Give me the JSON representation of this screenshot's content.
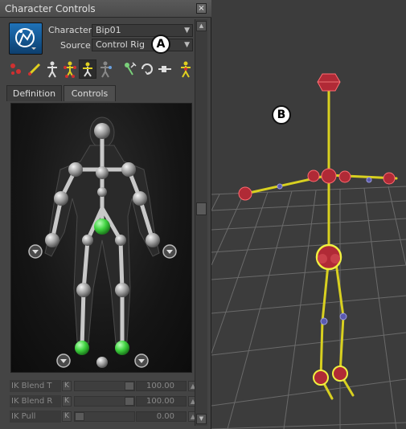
{
  "window": {
    "title": "Character Controls",
    "close_label": "×"
  },
  "character": {
    "label": "Character:",
    "value": "Bip01"
  },
  "source": {
    "label": "Source:",
    "value": "Control Rig"
  },
  "callouts": {
    "a": "A",
    "b": "B"
  },
  "tabs": [
    {
      "label": "Definition"
    },
    {
      "label": "Controls"
    }
  ],
  "toolbar": {
    "icons": [
      "effector-select-icon",
      "pin-effector-icon",
      "full-body-icon",
      "body-part-icon",
      "selection-icon",
      "pick-icon",
      "move-effector-icon",
      "rotate-effector-icon",
      "pin-icon",
      "reach-icon"
    ]
  },
  "properties": [
    {
      "label": "IK Blend T",
      "key": "K",
      "value": "100.00",
      "slider": 1.0
    },
    {
      "label": "IK Blend R",
      "key": "K",
      "value": "100.00",
      "slider": 1.0
    },
    {
      "label": "IK Pull",
      "key": "K",
      "value": "0.00",
      "slider": 0.0
    }
  ],
  "colors": {
    "active_effector": "#3fd23f",
    "bone_yellow": "#d8d020",
    "joint_red": "#c0303a",
    "viewport_bg": "#3c3c3c"
  }
}
